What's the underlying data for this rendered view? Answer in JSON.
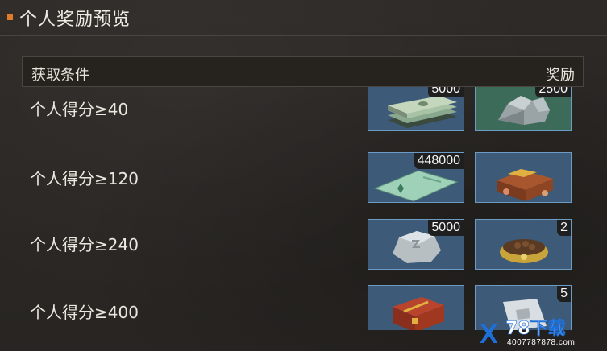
{
  "title": "个人奖励预览",
  "header": {
    "condition": "获取条件",
    "reward": "奖励"
  },
  "rows": [
    {
      "label": "个人得分≥40",
      "rewards": [
        {
          "icon": "cash-stack-icon",
          "count": "5000"
        },
        {
          "icon": "silver-ore-icon",
          "count": "2500"
        }
      ]
    },
    {
      "label": "个人得分≥120",
      "rewards": [
        {
          "icon": "voucher-icon",
          "count": "448000"
        },
        {
          "icon": "food-crate-icon",
          "count": ""
        }
      ]
    },
    {
      "label": "个人得分≥240",
      "rewards": [
        {
          "icon": "stone-icon",
          "count": "5000"
        },
        {
          "icon": "pet-food-bowl-icon",
          "count": "2"
        }
      ]
    },
    {
      "label": "个人得分≥400",
      "rewards": [
        {
          "icon": "treasure-chest-icon",
          "count": ""
        },
        {
          "icon": "packet-icon",
          "count": "5"
        }
      ]
    }
  ],
  "watermark": {
    "mark": "X",
    "brand": "78下载",
    "url": "4007787878.com"
  }
}
